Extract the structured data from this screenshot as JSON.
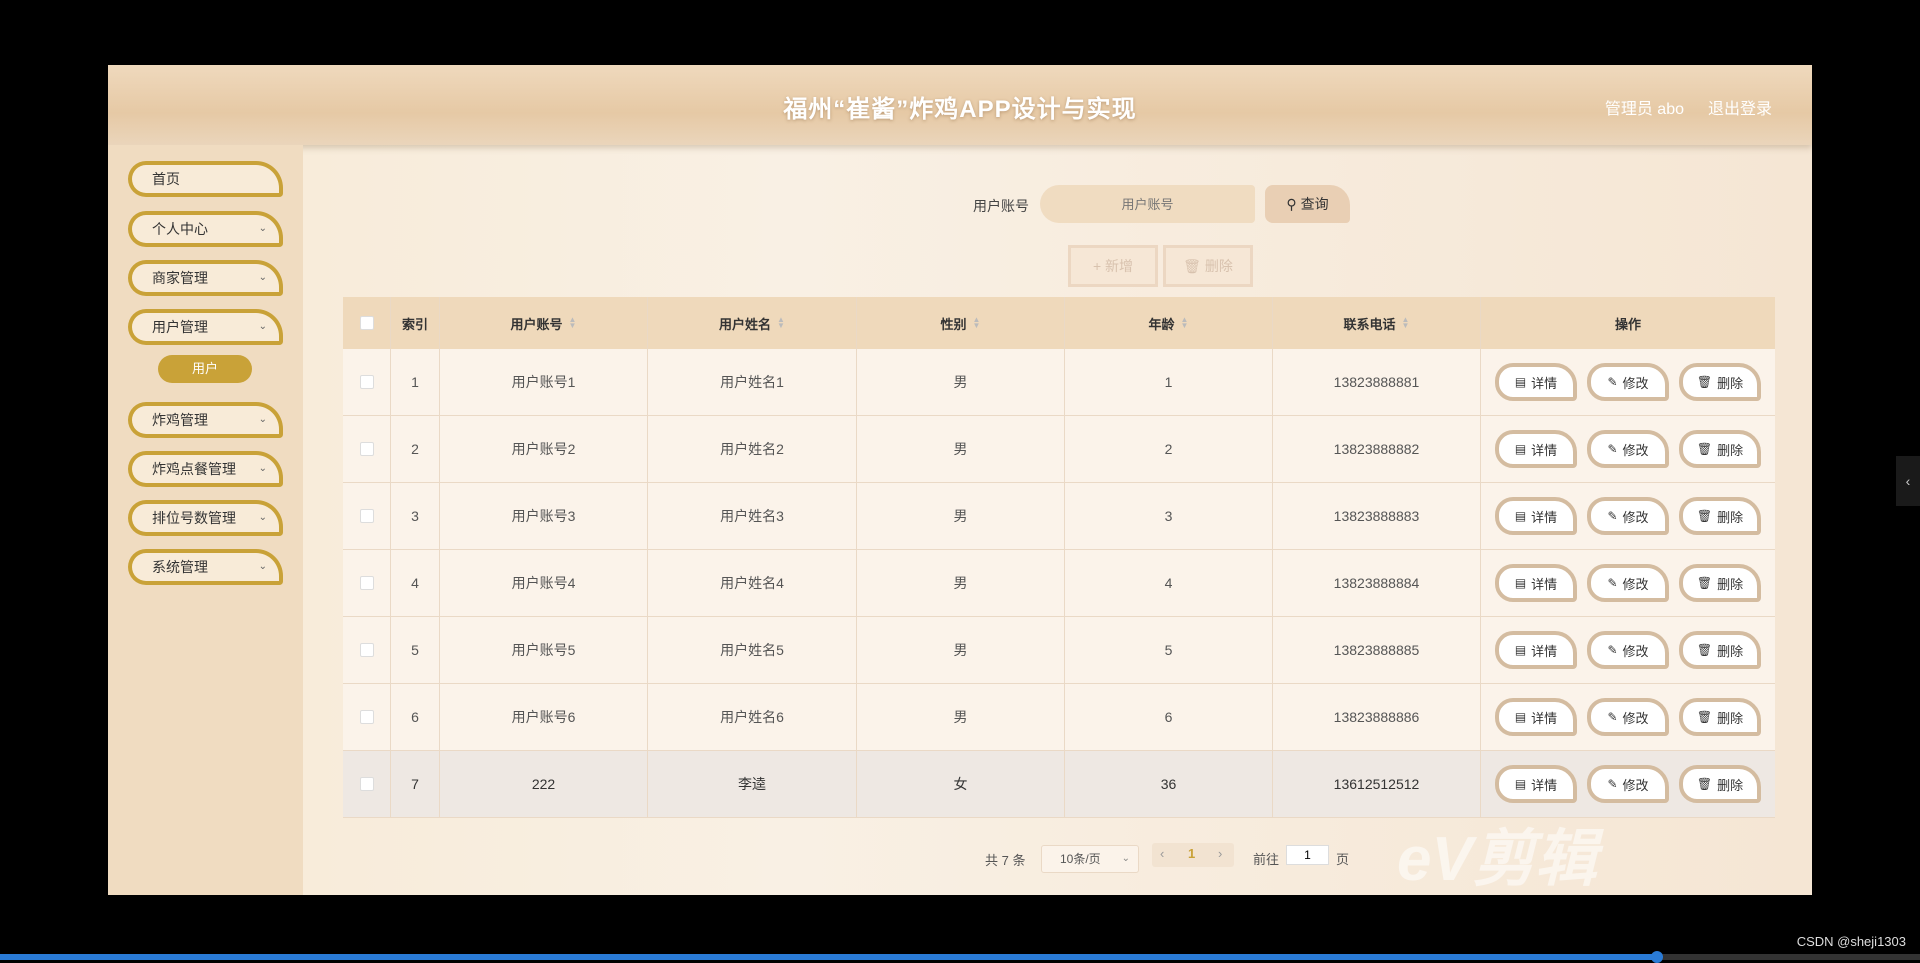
{
  "header": {
    "title": "福州“崔酱”炸鸡APP设计与实现",
    "user": "管理员 abo",
    "logout": "退出登录"
  },
  "sidebar": {
    "items": [
      {
        "label": "首页"
      },
      {
        "label": "个人中心"
      },
      {
        "label": "商家管理"
      },
      {
        "label": "用户管理"
      },
      {
        "label": "炸鸡管理"
      },
      {
        "label": "炸鸡点餐管理"
      },
      {
        "label": "排位号数管理"
      },
      {
        "label": "系统管理"
      }
    ],
    "submenu": "用户"
  },
  "search": {
    "label": "用户账号",
    "placeholder": "用户账号",
    "button": "查询"
  },
  "actions": {
    "add": "新增",
    "delete": "删除"
  },
  "table": {
    "headers": [
      "索引",
      "用户账号",
      "用户姓名",
      "性别",
      "年龄",
      "联系电话",
      "操作"
    ],
    "rows": [
      {
        "index": "1",
        "account": "用户账号1",
        "name": "用户姓名1",
        "gender": "男",
        "age": "1",
        "phone": "13823888881"
      },
      {
        "index": "2",
        "account": "用户账号2",
        "name": "用户姓名2",
        "gender": "男",
        "age": "2",
        "phone": "13823888882"
      },
      {
        "index": "3",
        "account": "用户账号3",
        "name": "用户姓名3",
        "gender": "男",
        "age": "3",
        "phone": "13823888883"
      },
      {
        "index": "4",
        "account": "用户账号4",
        "name": "用户姓名4",
        "gender": "男",
        "age": "4",
        "phone": "13823888884"
      },
      {
        "index": "5",
        "account": "用户账号5",
        "name": "用户姓名5",
        "gender": "男",
        "age": "5",
        "phone": "13823888885"
      },
      {
        "index": "6",
        "account": "用户账号6",
        "name": "用户姓名6",
        "gender": "男",
        "age": "6",
        "phone": "13823888886"
      },
      {
        "index": "7",
        "account": "222",
        "name": "李逵",
        "gender": "女",
        "age": "36",
        "phone": "13612512512"
      }
    ],
    "op_labels": {
      "detail": "详情",
      "edit": "修改",
      "delete": "删除"
    }
  },
  "pagination": {
    "total": "共 7 条",
    "page_size": "10条/页",
    "current": "1",
    "goto_label": "前往",
    "goto_value": "1",
    "page_suffix": "页"
  },
  "watermark": "eV剪辑",
  "credit": "CSDN @sheji1303",
  "video_progress": 0.863,
  "colors": {
    "accent_gold": "#c9a238",
    "header_bg": "#e6c9a5",
    "sidebar_bg": "#f0dcc1"
  }
}
